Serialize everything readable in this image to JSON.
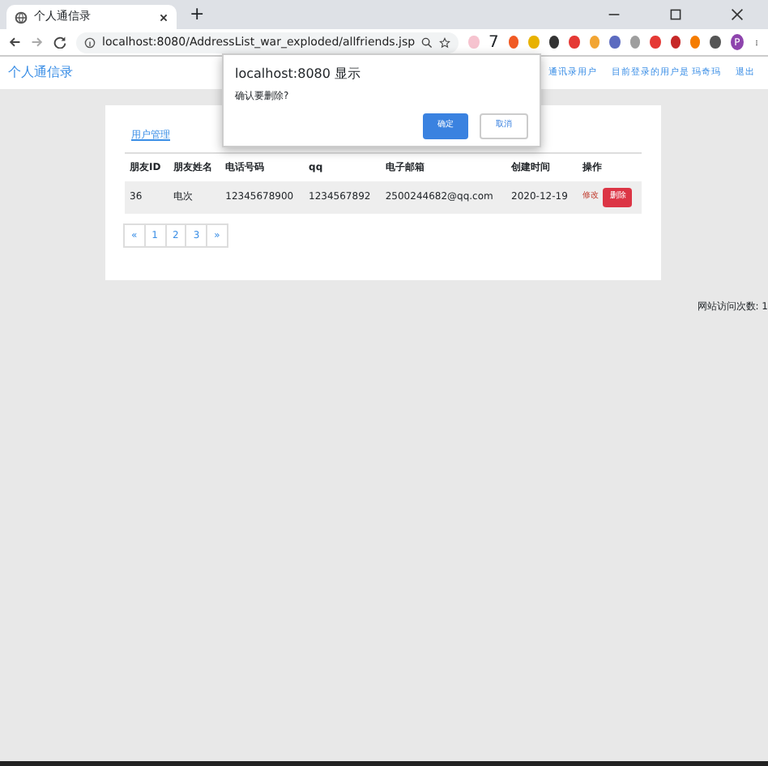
{
  "browser": {
    "tab_title": "个人通信录",
    "new_tab": "+",
    "url": "localhost:8080/AddressList_war_exploded/allfriends.jsp",
    "extension_badge": "7",
    "profile": "P"
  },
  "navbar": {
    "brand": "个人通信录",
    "links": [
      "通讯录用户",
      "目前登录的用户是 玛奇玛",
      "退出"
    ]
  },
  "section_title": "用户管理",
  "table": {
    "columns": [
      "朋友ID",
      "朋友姓名",
      "电话号码",
      "qq",
      "电子邮箱",
      "创建时间",
      "操作"
    ],
    "rows": [
      {
        "cells": [
          "36",
          "电次",
          "12345678900",
          "1234567892",
          "2500244682@qq.com",
          "2020-12-19"
        ],
        "edit": "修改",
        "delete": "删除"
      }
    ]
  },
  "pagination": [
    {
      "label": "«",
      "selected": false
    },
    {
      "label": "1",
      "selected": false
    },
    {
      "label": "2",
      "selected": false
    },
    {
      "label": "3",
      "selected": false
    },
    {
      "label": "»",
      "selected": false
    }
  ],
  "visit_count": "网站访问次数: 1",
  "dialog": {
    "title": "localhost:8080 显示",
    "message": "确认要删除?",
    "ok": "确定",
    "cancel": "取消"
  }
}
